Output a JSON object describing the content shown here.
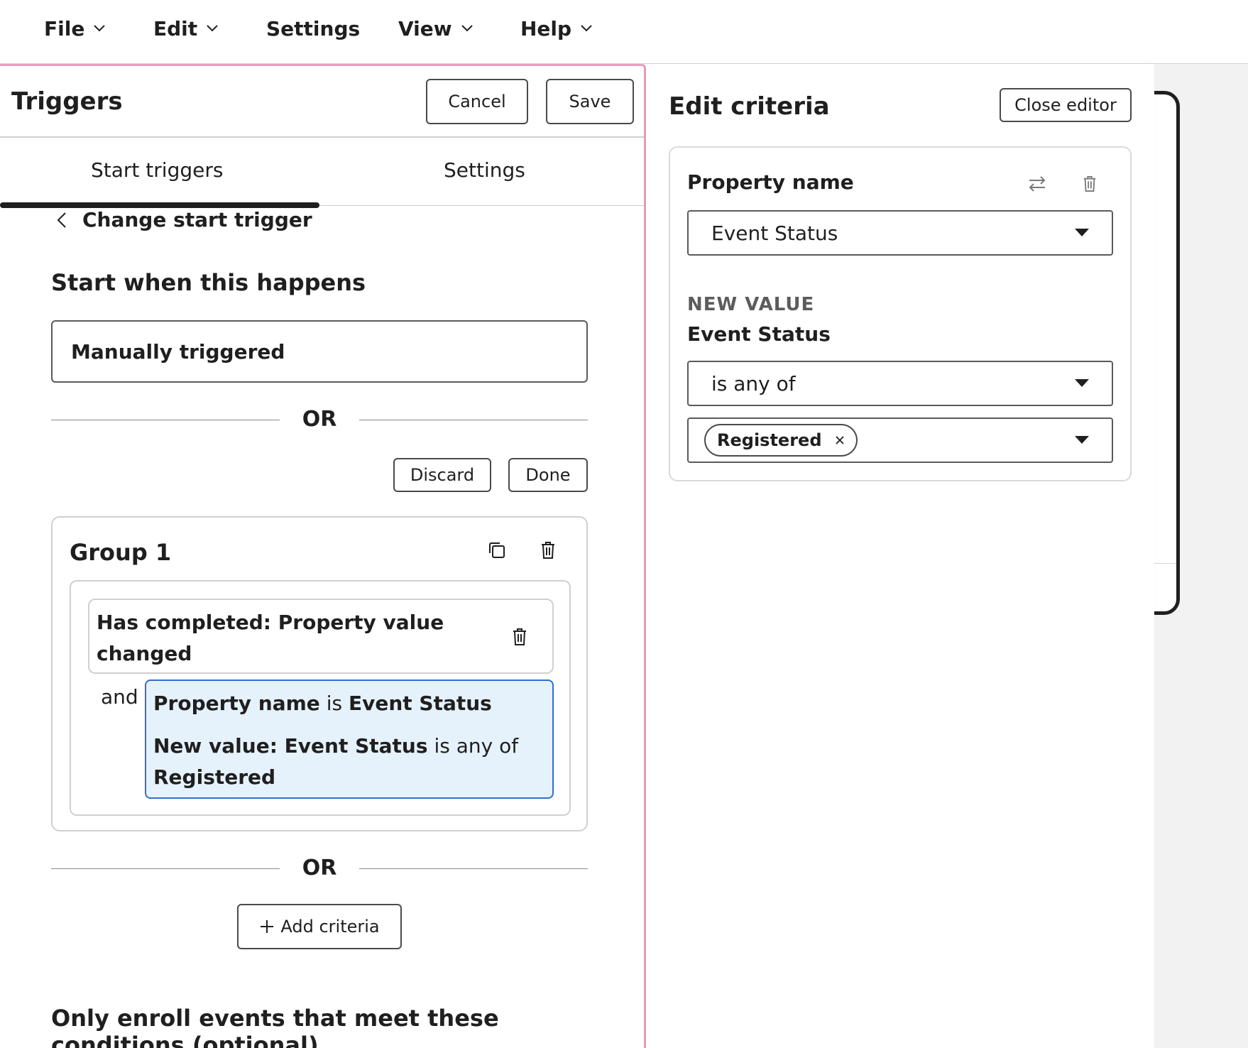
{
  "menu": {
    "file": "File",
    "edit": "Edit",
    "settings": "Settings",
    "view": "View",
    "help": "Help"
  },
  "triggers_panel": {
    "title": "Triggers",
    "cancel_label": "Cancel",
    "save_label": "Save",
    "tabs": [
      {
        "label": "Start triggers",
        "active": true
      },
      {
        "label": "Settings",
        "active": false
      }
    ],
    "back_link": "Change start trigger",
    "start_heading": "Start when this happens",
    "manual_trigger": "Manually triggered",
    "or_label": "OR",
    "discard_label": "Discard",
    "done_label": "Done",
    "group": {
      "title": "Group 1",
      "completed_text": "Has completed: Property value changed",
      "and_label": "and",
      "criteria": {
        "prop_label": "Property name",
        "is_word": "is",
        "prop_value": "Event Status",
        "new_value_label": "New value: Event Status",
        "is_any_of": "is any of",
        "selected_value": "Registered"
      }
    },
    "add_criteria_label": "Add criteria",
    "conditions_heading": "Only enroll events that meet these conditions (optional)"
  },
  "editor": {
    "title": "Edit criteria",
    "close_label": "Close editor",
    "property_label": "Property name",
    "property_select": "Event Status",
    "new_value_caps": "NEW VALUE",
    "new_value_label": "Event Status",
    "operator_select": "is any of",
    "chip_value": "Registered"
  },
  "colors": {
    "accent_pink": "#e8a0bf",
    "criteria_bg": "#e6f2fb",
    "criteria_border": "#2f6fcf"
  }
}
